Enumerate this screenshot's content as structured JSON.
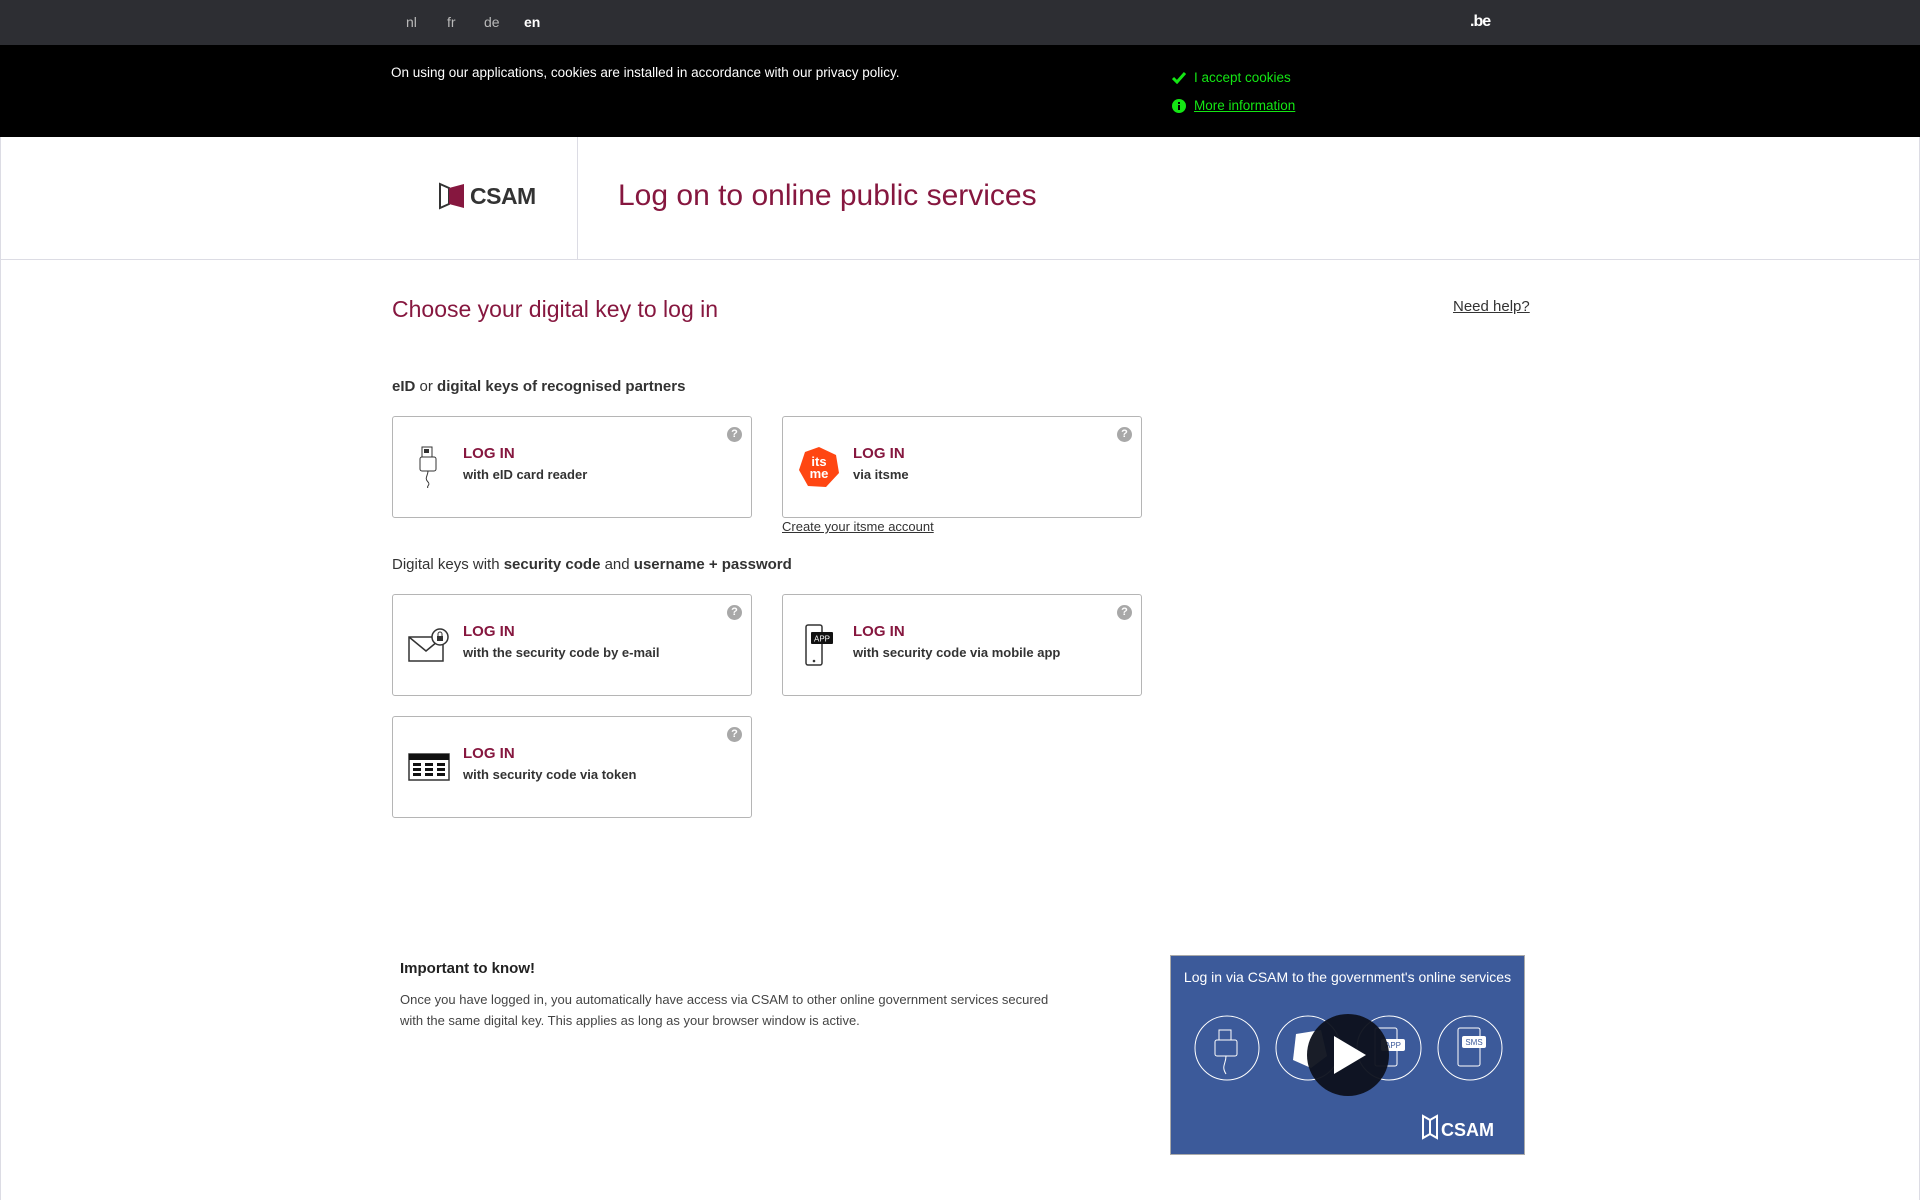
{
  "languages": [
    {
      "code": "nl",
      "active": false
    },
    {
      "code": "fr",
      "active": false
    },
    {
      "code": "de",
      "active": false
    },
    {
      "code": "en",
      "active": true
    }
  ],
  "brand_domain": ".be",
  "cookie": {
    "text": "On using our applications, cookies are installed in accordance with our privacy policy.",
    "accept": "I accept cookies",
    "more": "More information",
    "accent": "#14e614"
  },
  "header": {
    "logo": "CSAM",
    "title": "Log on to online public services"
  },
  "main": {
    "heading": "Choose your digital key to log in",
    "help": "Need help?",
    "section1": {
      "a": "eID",
      "b": " or ",
      "c": "digital keys of recognised partners"
    },
    "section2": {
      "a": "Digital keys with ",
      "b": "security code",
      "c": " and ",
      "d": "username + password"
    },
    "cards": [
      {
        "title": "LOG IN",
        "subtitle": "with eID card reader",
        "icon": "card-reader-icon"
      },
      {
        "title": "LOG IN",
        "subtitle": "via itsme",
        "icon": "itsme-icon"
      },
      {
        "title": "LOG IN",
        "subtitle": "with the security code by e-mail",
        "icon": "email-lock-icon"
      },
      {
        "title": "LOG IN",
        "subtitle": "with security code via mobile app",
        "icon": "mobile-app-icon"
      },
      {
        "title": "LOG IN",
        "subtitle": "with security code via token",
        "icon": "token-icon"
      }
    ],
    "help_glyph": "?",
    "itsme_link": "Create your itsme account",
    "important": {
      "title": "Important to know!",
      "text": "Once you have logged in, you automatically have access via CSAM to other online government services secured with the same digital key. This applies as long as your browser window is active."
    },
    "video": {
      "title": "Log in via CSAM to the government's online services",
      "logo": "CSAM",
      "sms": "SMS",
      "app": "APP"
    }
  },
  "colors": {
    "accent": "#86173f",
    "topbar": "#2d2e33",
    "video_bg": "#3c5a9a"
  }
}
